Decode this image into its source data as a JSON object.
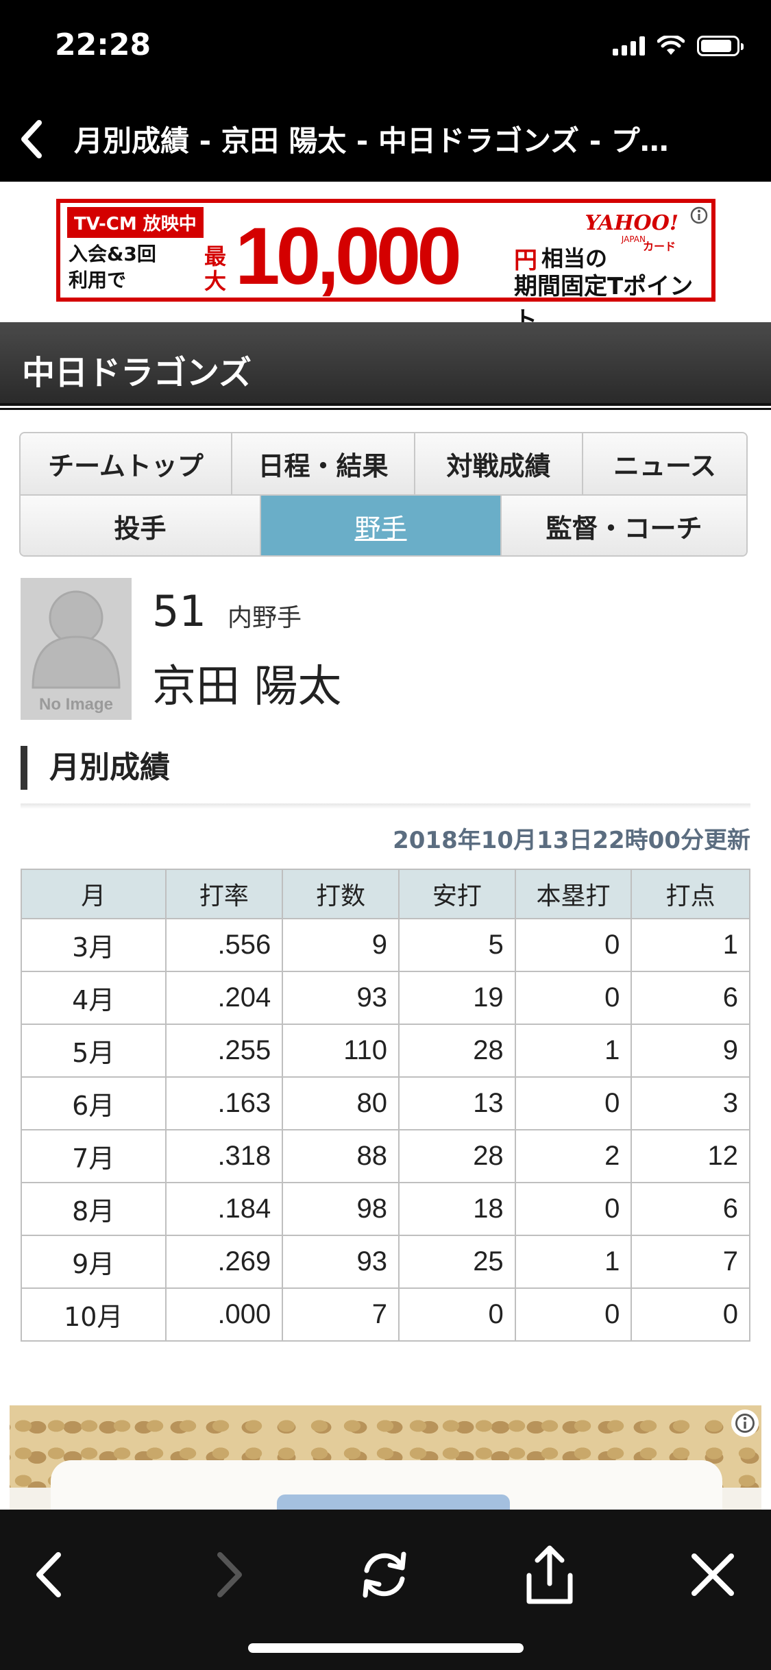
{
  "status_bar": {
    "time": "22:28"
  },
  "nav": {
    "title": "月別成績 - 京田 陽太 - 中日ドラゴンズ - プ…"
  },
  "ad_banner": {
    "tag": "TV-CM 放映中",
    "line1": "入会&3回",
    "line2": "利用で",
    "max": "最大",
    "amount": "10,000",
    "unit": "円",
    "equiv": "相当の",
    "point": "期間固定Tポイント",
    "brand": "YAHOO!",
    "brand_sub": "JAPAN",
    "brand_suffix": "カード"
  },
  "team": {
    "title": "中日ドラゴンズ"
  },
  "tabs": {
    "row1": [
      "チームトップ",
      "日程・結果",
      "対戦成績",
      "ニュース"
    ],
    "row2": [
      "投手",
      "野手",
      "監督・コーチ"
    ],
    "active": "野手"
  },
  "player": {
    "photo_caption": "No Image",
    "number": "51",
    "position": "内野手",
    "name": "京田 陽太"
  },
  "section": {
    "title": "月別成績",
    "updated": "2018年10月13日22時00分更新"
  },
  "table": {
    "headers": [
      "月",
      "打率",
      "打数",
      "安打",
      "本塁打",
      "打点"
    ],
    "rows": [
      [
        "3月",
        ".556",
        "9",
        "5",
        "0",
        "1"
      ],
      [
        "4月",
        ".204",
        "93",
        "19",
        "0",
        "6"
      ],
      [
        "5月",
        ".255",
        "110",
        "28",
        "1",
        "9"
      ],
      [
        "6月",
        ".163",
        "80",
        "13",
        "0",
        "3"
      ],
      [
        "7月",
        ".318",
        "88",
        "28",
        "2",
        "12"
      ],
      [
        "8月",
        ".184",
        "98",
        "18",
        "0",
        "6"
      ],
      [
        "9月",
        ".269",
        "93",
        "25",
        "1",
        "7"
      ],
      [
        "10月",
        ".000",
        "7",
        "0",
        "0",
        "0"
      ]
    ]
  },
  "toolbar": {
    "icons": [
      "back-icon",
      "forward-icon",
      "reload-icon",
      "share-icon",
      "close-icon"
    ]
  },
  "colors": {
    "active_tab": "#6aaec8",
    "table_header": "#d6e3e6",
    "ad_red": "#d40000",
    "updated_text": "#5b6d80"
  }
}
